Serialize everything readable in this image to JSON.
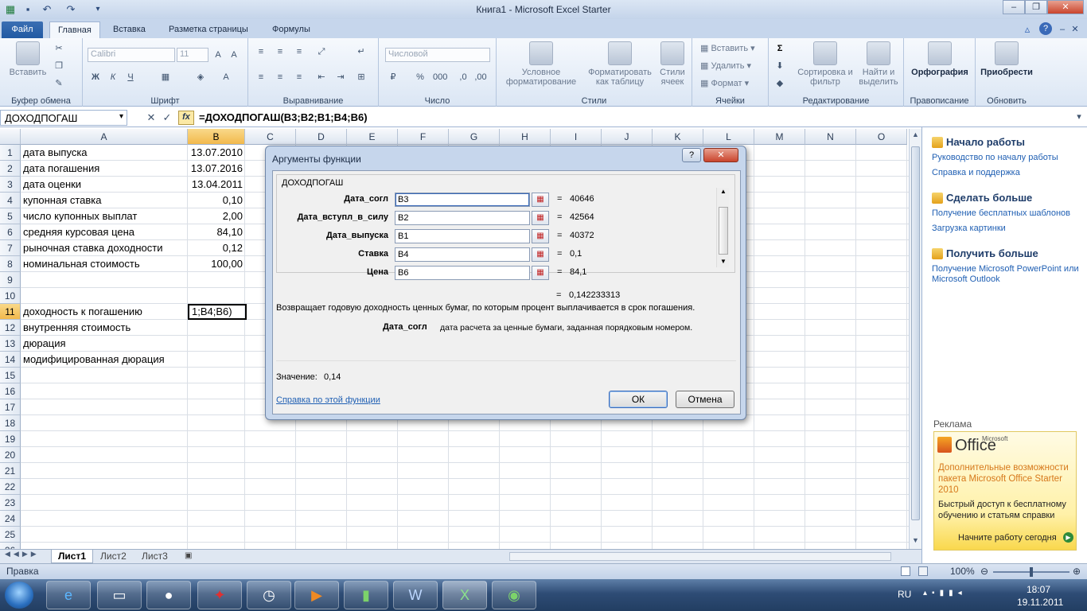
{
  "window": {
    "title": "Книга1  -  Microsoft Excel Starter"
  },
  "tabs": [
    "Файл",
    "Главная",
    "Вставка",
    "Разметка страницы",
    "Формулы"
  ],
  "ribbon": {
    "clipboard": {
      "paste": "Вставить",
      "label": "Буфер обмена"
    },
    "font": {
      "name": "Calibri",
      "size": "11",
      "label": "Шрифт"
    },
    "alignment": {
      "label": "Выравнивание"
    },
    "number": {
      "format": "Числовой",
      "label": "Число"
    },
    "styles": {
      "cond": "Условное форматирование",
      "table": "Форматировать как таблицу",
      "cell": "Стили ячеек",
      "label": "Стили"
    },
    "cells": {
      "insert": "Вставить",
      "delete": "Удалить",
      "format": "Формат",
      "label": "Ячейки"
    },
    "editing": {
      "sort": "Сортировка и фильтр",
      "find": "Найти и выделить",
      "label": "Редактирование"
    },
    "spelling": {
      "btn": "Орфография",
      "label": "Правописание"
    },
    "updates": {
      "btn": "Приобрести",
      "label": "Обновить"
    }
  },
  "formula_bar": {
    "name": "ДОХОДПОГАШ",
    "formula": "=ДОХОДПОГАШ(B3;B2;B1;B4;B6)"
  },
  "columns": [
    "A",
    "B",
    "C",
    "D",
    "E",
    "F",
    "G",
    "H",
    "I",
    "J",
    "K",
    "L",
    "M",
    "N",
    "O"
  ],
  "rows": [
    "1",
    "2",
    "3",
    "4",
    "5",
    "6",
    "7",
    "8",
    "9",
    "10",
    "11",
    "12",
    "13",
    "14",
    "15",
    "16",
    "17",
    "18",
    "19",
    "20",
    "21",
    "22",
    "23",
    "24",
    "25",
    "26"
  ],
  "cells": {
    "a1": "дата выпуска",
    "b1": "13.07.2010",
    "a2": "дата погашения",
    "b2": "13.07.2016",
    "a3": "дата оценки",
    "b3": "13.04.2011",
    "a4": "купонная ставка",
    "b4": "0,10",
    "a5": "число купонных выплат",
    "b5": "2,00",
    "a6": "средняя курсовая цена",
    "b6": "84,10",
    "a7": "рыночная ставка доходности",
    "b7": "0,12",
    "a8": "номинальная стоимость",
    "b8": "100,00",
    "a11": "доходность к погашению",
    "b11": "1;B4;B6)",
    "a12": "внутренняя стоимость",
    "a13": "дюрация",
    "a14": "модифицированная дюрация"
  },
  "sheet_tabs": [
    "Лист1",
    "Лист2",
    "Лист3"
  ],
  "status": {
    "mode": "Правка",
    "zoom": "100%"
  },
  "dialog": {
    "title": "Аргументы функции",
    "func": "ДОХОДПОГАШ",
    "args": [
      {
        "label": "Дата_согл",
        "value": "B3",
        "result": "40646"
      },
      {
        "label": "Дата_вступл_в_силу",
        "value": "B2",
        "result": "42564"
      },
      {
        "label": "Дата_выпуска",
        "value": "B1",
        "result": "40372"
      },
      {
        "label": "Ставка",
        "value": "B4",
        "result": "0,1"
      },
      {
        "label": "Цена",
        "value": "B6",
        "result": "84,1"
      }
    ],
    "result": "0,142233313",
    "desc": "Возвращает годовую доходность ценных бумаг, по которым процент выплачивается в срок погашения.",
    "arg_name": "Дата_согл",
    "arg_desc": "дата расчета за ценные бумаги, заданная порядковым номером.",
    "value_label": "Значение:",
    "value": "0,14",
    "help": "Справка по этой функции",
    "ok": "ОК",
    "cancel": "Отмена"
  },
  "side": {
    "h1": "Начало работы",
    "l1a": "Руководство по началу работы",
    "l1b": "Справка и поддержка",
    "h2": "Сделать больше",
    "l2a": "Получение бесплатных шаблонов",
    "l2b": "Загрузка картинки",
    "h3": "Получить больше",
    "l3a": "Получение Microsoft PowerPoint или Microsoft Outlook",
    "ad_label": "Реклама",
    "ad_brand": "Office",
    "ad_ms": "Microsoft",
    "ad_title": "Дополнительные возможности пакета Microsoft Office Starter 2010",
    "ad_text": "Быстрый доступ к бесплатному обучению и статьям справки",
    "ad_link": "Начните работу сегодня"
  },
  "taskbar": {
    "lang": "RU",
    "time": "18:07",
    "date": "19.11.2011"
  }
}
